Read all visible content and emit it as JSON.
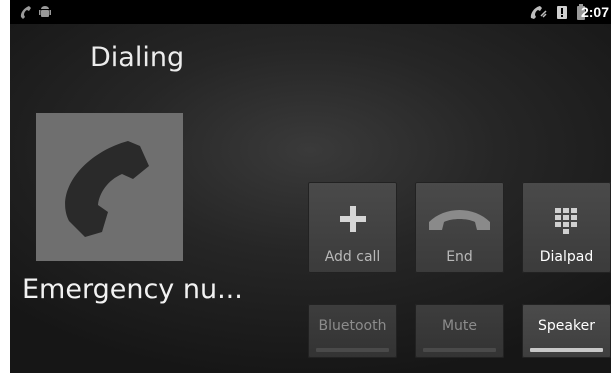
{
  "status_bar": {
    "time": "2:07",
    "icons": [
      "missed-call-icon",
      "android-debug-icon",
      "call-in-progress-icon",
      "sim-alert-icon",
      "battery-icon"
    ]
  },
  "call": {
    "state": "Dialing",
    "caller_name": "Emergency nu...",
    "photo_icon": "phone-handset-icon"
  },
  "buttons": {
    "add_call": "Add call",
    "end": "End",
    "dialpad": "Dialpad",
    "bluetooth": "Bluetooth",
    "mute": "Mute",
    "speaker": "Speaker"
  },
  "toggles": {
    "bluetooth_on": false,
    "mute_on": false,
    "speaker_on": true
  }
}
